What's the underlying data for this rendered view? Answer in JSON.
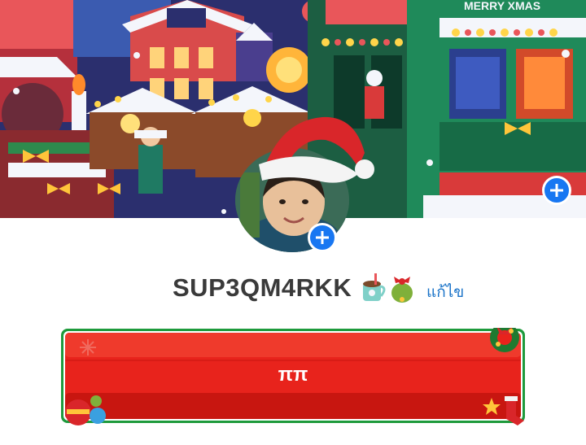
{
  "cover": {
    "sign_text": "MERRY XMAS",
    "colors": {
      "sky": "#2b2f6e",
      "house_red": "#c43a3a",
      "roof_snow": "#f4f6fb",
      "tram_green": "#1f8a5a",
      "lights": "#ffd54a"
    }
  },
  "profile": {
    "username": "SUP3QM4RKK",
    "edit_label": "แก้ไข",
    "avatar_icon": "profile-photo-with-santa-hat",
    "add_icon": "plus-icon"
  },
  "banner_button": {
    "label": "ππ",
    "colors": {
      "fill": "#e8231c",
      "fill_dark": "#c81610",
      "frame": "#1e9a3c",
      "stripe": "#ffffff"
    }
  }
}
